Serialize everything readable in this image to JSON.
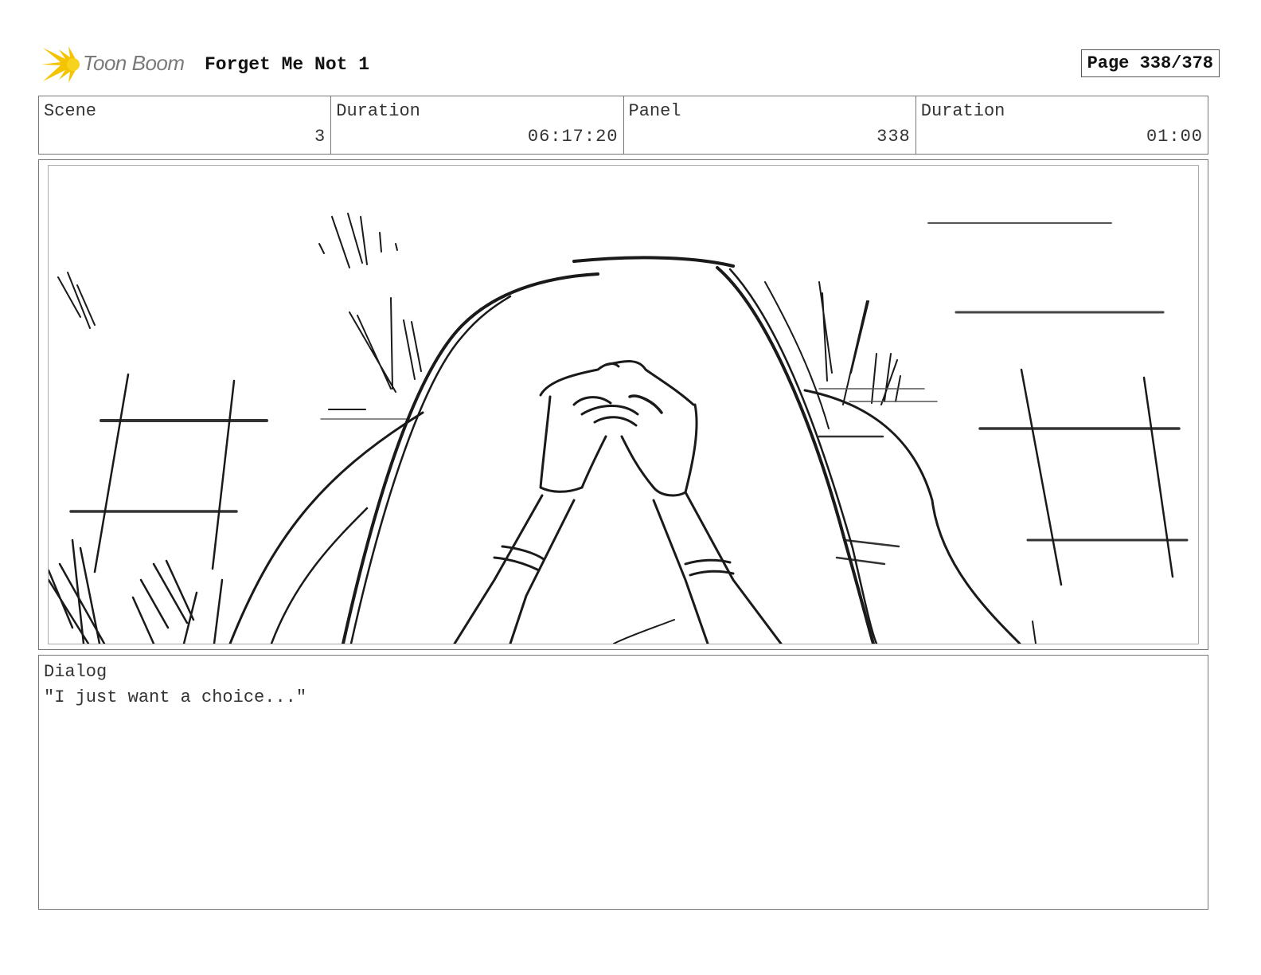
{
  "header": {
    "logo_text": "Toon Boom",
    "project_title": "Forget Me Not 1",
    "page_label": "Page 338/378"
  },
  "info": {
    "scene_label": "Scene",
    "scene_value": "3",
    "scene_duration_label": "Duration",
    "scene_duration_value": "06:17:20",
    "panel_label": "Panel",
    "panel_value": "338",
    "panel_duration_label": "Duration",
    "panel_duration_value": "01:00"
  },
  "dialog": {
    "label": "Dialog",
    "text": "\"I just want a choice...\""
  },
  "colors": {
    "logo_accent": "#f5c400",
    "ink": "#1a1a1a",
    "border": "#777777"
  }
}
